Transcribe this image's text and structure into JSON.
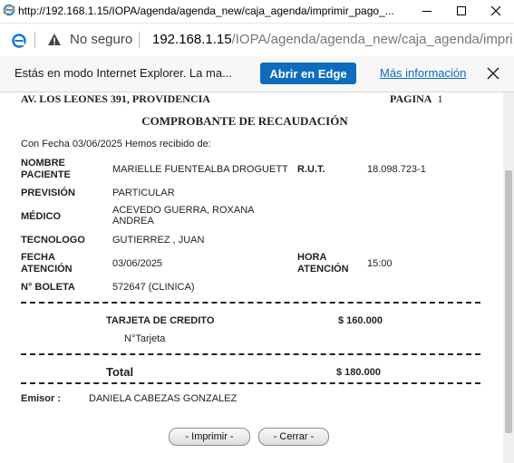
{
  "window": {
    "title_url": "http://192.168.1.15/IOPA/agenda/agenda_new/caja_agenda/imprimir_pago_..."
  },
  "address_bar": {
    "security_label": "No seguro",
    "url_host": "192.168.1.15",
    "url_path": "/IOPA/agenda/agenda_new/caja_agenda/impri..."
  },
  "banner": {
    "message": "Estás en modo Internet Explorer. La ma...",
    "edge_button": "Abrir en Edge",
    "more_info": "Más información"
  },
  "receipt": {
    "address": "AV. LOS LEONES 391, PROVIDENCIA",
    "page_label": "PAGINA",
    "page_number": "1",
    "title": "COMPROBANTE DE RECAUDACIÓN",
    "intro": "Con Fecha 03/06/2025 Hemos recibido de:",
    "patient_label_1": "NOMBRE",
    "patient_label_2": "PACIENTE",
    "patient_value": "MARIELLE FUENTEALBA DROGUETT",
    "rut_label": "R.U.T.",
    "rut_value": "18.098.723-1",
    "prevision_label": "PREVISIÓN",
    "prevision_value": "PARTICULAR",
    "medico_label": "MÉDICO",
    "medico_value_1": "ACEVEDO GUERRA, ROXANA",
    "medico_value_2": "ANDREA",
    "tecnologo_label": "TECNOLOGO",
    "tecnologo_value": "GUTIERREZ , JUAN",
    "fecha_label_1": "FECHA",
    "fecha_label_2": "ATENCIÓN",
    "fecha_value": "03/06/2025",
    "hora_label_1": "HORA",
    "hora_label_2": "ATENCIÓN",
    "hora_value": "15:00",
    "boleta_label": "N° BOLETA",
    "boleta_value": "572647 (CLINICA)",
    "payment_method": "TARJETA DE CREDITO",
    "payment_amount": "$ 160.000",
    "card_label": "N°Tarjeta",
    "total_label": "Total",
    "total_amount": "$ 180.000",
    "emisor_label": "Emisor :",
    "emisor_value": "DANIELA CABEZAS GONZALEZ",
    "print_button": "- Imprimir -",
    "close_button": "- Cerrar -"
  }
}
